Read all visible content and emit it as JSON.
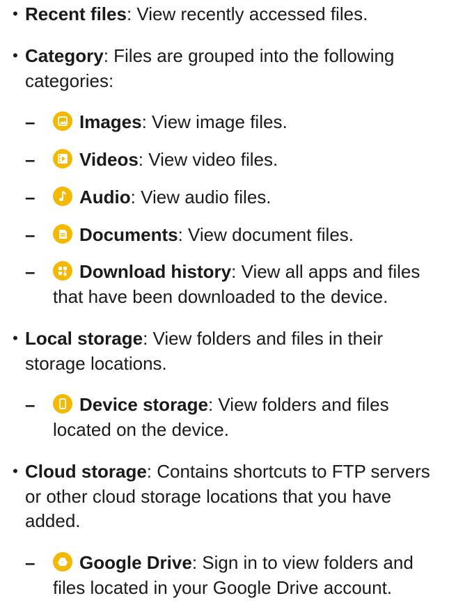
{
  "items": [
    {
      "title": "Recent files",
      "desc": ": View recently accessed files."
    },
    {
      "title": "Category",
      "desc_line1": ": Files are grouped into the following",
      "desc_line2": "categories:",
      "children": [
        {
          "icon": "image-icon",
          "title": "Images",
          "desc": ": View image files."
        },
        {
          "icon": "video-icon",
          "title": "Videos",
          "desc": ": View video files."
        },
        {
          "icon": "audio-icon",
          "title": "Audio",
          "desc": ": View audio files."
        },
        {
          "icon": "document-icon",
          "title": "Documents",
          "desc": ": View document files."
        },
        {
          "icon": "download-icon",
          "title": "Download history",
          "desc_line1": ": View all apps and files",
          "desc_line2": "that have been downloaded to the device."
        }
      ]
    },
    {
      "title": "Local storage",
      "desc_line1": ": View folders and files in their",
      "desc_line2": "storage locations.",
      "children": [
        {
          "icon": "phone-icon",
          "title": "Device storage",
          "desc_line1": ": View folders and files",
          "desc_line2": "located on the device."
        }
      ]
    },
    {
      "title": "Cloud storage",
      "desc_line1": ": Contains shortcuts to FTP servers",
      "desc_line2": "or other cloud storage locations that you have",
      "desc_line3": "added.",
      "children": [
        {
          "icon": "google-drive-icon",
          "title": "Google Drive",
          "desc_line1": ": Sign in to view folders and",
          "desc_line2": "files located in your Google Drive account."
        }
      ]
    }
  ],
  "bullet_char": "•",
  "dash_char": "–",
  "icon_color": "#f5b800"
}
